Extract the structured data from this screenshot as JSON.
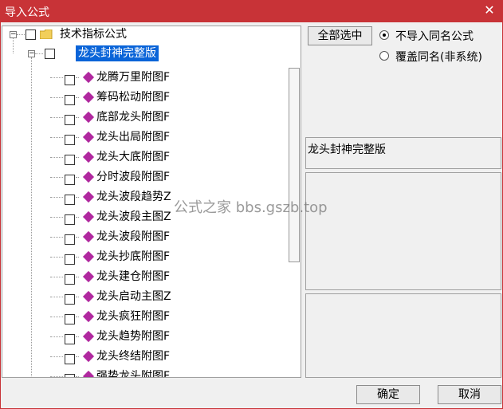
{
  "window": {
    "title": "导入公式",
    "close_glyph": "✕"
  },
  "tree": {
    "root_label": "技术指标公式",
    "group_label": "龙头封神完整版",
    "expander_glyph": "−",
    "items": [
      "龙腾万里附图F",
      "筹码松动附图F",
      "底部龙头附图F",
      "龙头出局附图F",
      "龙头大底附图F",
      "分时波段附图F",
      "龙头波段趋势Z",
      "龙头波段主图Z",
      "龙头波段附图F",
      "龙头抄底附图F",
      "龙头建仓附图F",
      "龙头启动主图Z",
      "龙头疯狂附图F",
      "龙头趋势附图F",
      "龙头终结附图F",
      "强势龙头附图F"
    ]
  },
  "options": {
    "select_all_label": "全部选中",
    "radio_skip_label": "不导入同名公式",
    "radio_overwrite_label": "覆盖同名(非系统)",
    "selected_radio": "skip"
  },
  "description": {
    "text": "龙头封神完整版"
  },
  "watermark": {
    "text": "公式之家 bbs.gszb.top"
  },
  "buttons": {
    "ok_label": "确定",
    "cancel_label": "取消"
  },
  "colors": {
    "titlebar": "#c83337",
    "selection": "#0a64d8",
    "formula_icon": "#b0289f"
  }
}
